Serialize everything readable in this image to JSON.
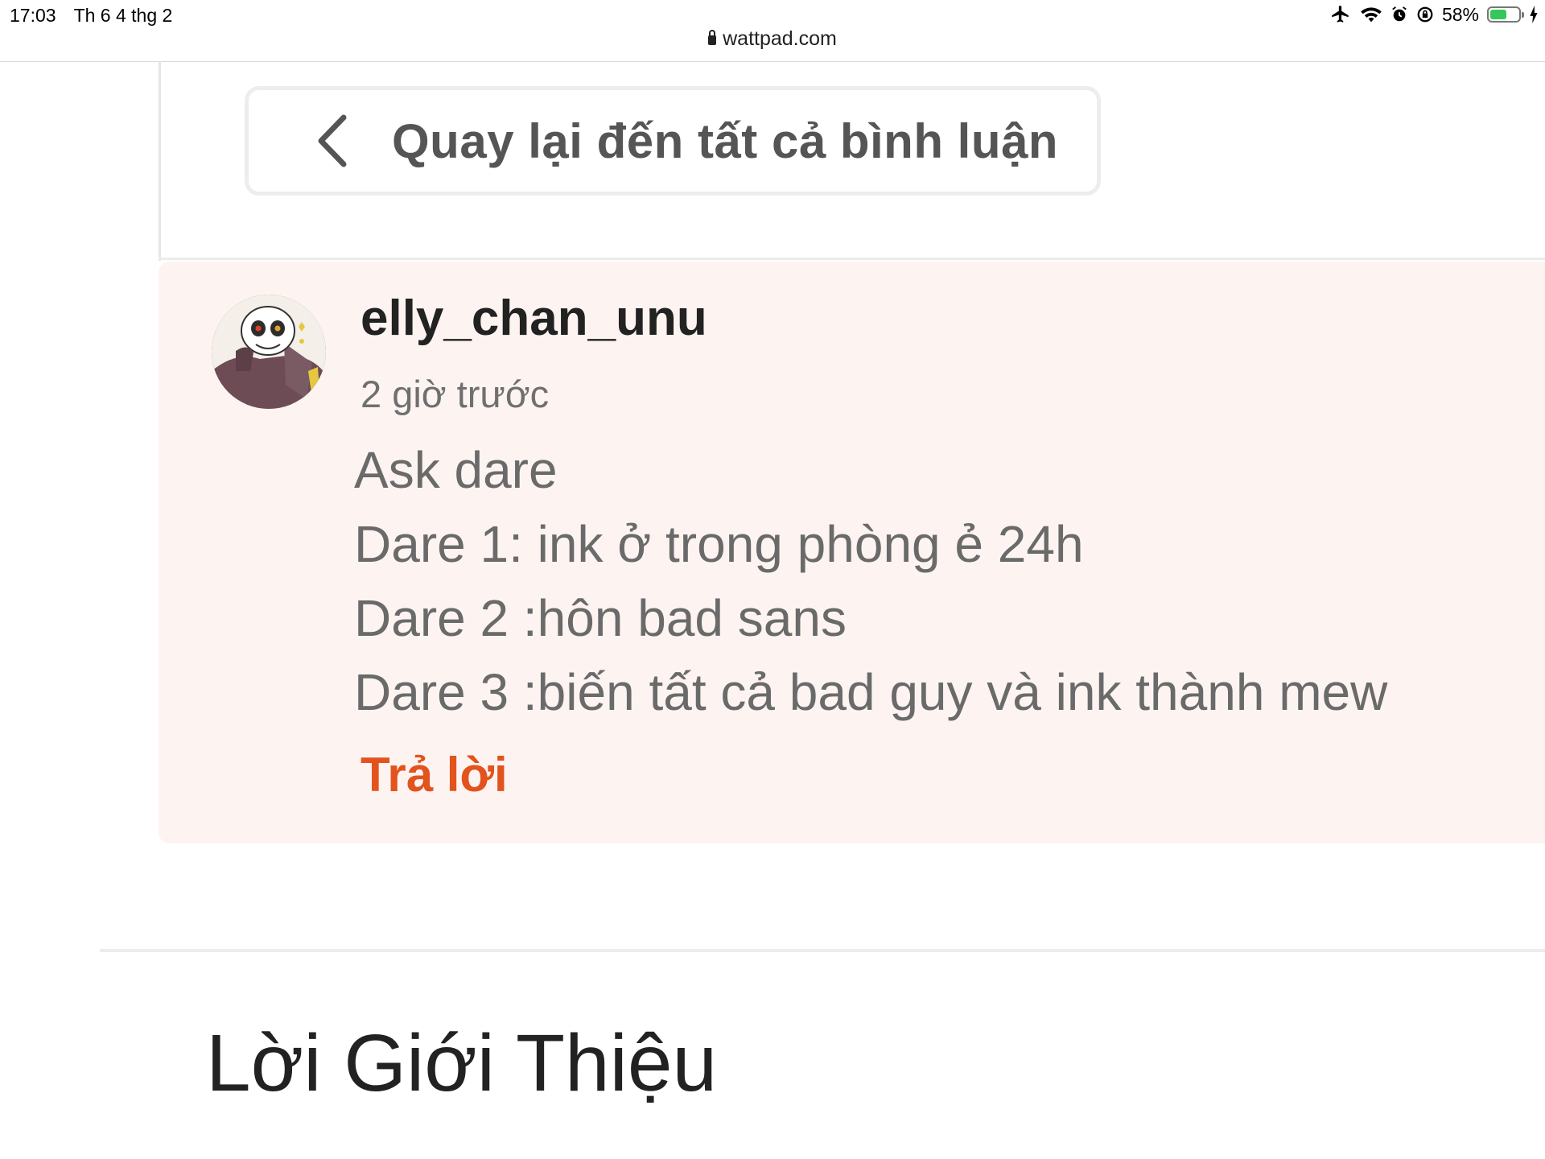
{
  "status_bar": {
    "time": "17:03",
    "date": "Th 6 4 thg 2",
    "battery_percent_text": "58%",
    "battery_level": 0.58,
    "icons": [
      "airplane-icon",
      "wifi-icon",
      "alarm-icon",
      "rotation-lock-icon",
      "battery-icon",
      "charging-icon"
    ]
  },
  "browser": {
    "url": "wattpad.com"
  },
  "back_button": {
    "label": "Quay lại đến tất cả bình luận",
    "icon": "chevron-left-icon"
  },
  "comment": {
    "username": "elly_chan_unu",
    "time_ago": "2 giờ trước",
    "lines": [
      "Ask dare",
      "Dare 1: ink ở trong phòng ẻ 24h",
      "Dare 2 :hôn bad sans",
      "Dare 3 :biến tất cả bad guy và ink thành mew"
    ],
    "reply_label": "Trả lời"
  },
  "section": {
    "title": "Lời Giới Thiệu"
  },
  "colors": {
    "accent": "#e2531d",
    "card_bg": "#fdf4f1"
  }
}
